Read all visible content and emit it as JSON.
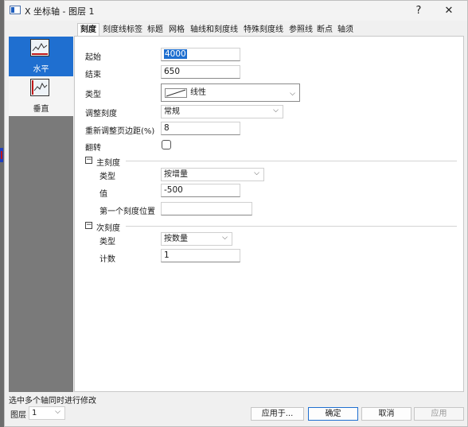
{
  "window": {
    "title": "X 坐标轴 - 图层 1",
    "help_label": "?",
    "close_label": "✕"
  },
  "sidebar": {
    "items": [
      {
        "label": "水平",
        "icon": "horizontal-axis-icon",
        "active": true
      },
      {
        "label": "垂直",
        "icon": "vertical-axis-icon",
        "active": false
      }
    ]
  },
  "tabs": [
    {
      "label": "刻度",
      "active": true
    },
    {
      "label": "刻度线标签"
    },
    {
      "label": "标题"
    },
    {
      "label": "网格"
    },
    {
      "label": "轴线和刻度线"
    },
    {
      "label": "特殊刻度线"
    },
    {
      "label": "参照线"
    },
    {
      "label": "断点"
    },
    {
      "label": "轴须"
    }
  ],
  "form": {
    "start": {
      "label": "起始",
      "value": "4000"
    },
    "end": {
      "label": "结束",
      "value": "650"
    },
    "type": {
      "label": "类型",
      "value": "线性"
    },
    "rescale": {
      "label": "调整刻度",
      "value": "常规"
    },
    "rescale_margin": {
      "label": "重新调整页边距(%)",
      "value": "8"
    },
    "flip": {
      "label": "翻转",
      "checked": false
    }
  },
  "major": {
    "header": "主刻度",
    "type_label": "类型",
    "type_value": "按增量",
    "value_label": "值",
    "value": "-500",
    "first_tick_label": "第一个刻度位置",
    "first_tick_value": ""
  },
  "minor": {
    "header": "次刻度",
    "type_label": "类型",
    "type_value": "按数量",
    "count_label": "计数",
    "count_value": "1"
  },
  "footer": {
    "status": "选中多个轴同时进行修改",
    "layer_label": "图层",
    "layer_value": "1",
    "apply_to": "应用于...",
    "ok": "确定",
    "cancel": "取消",
    "apply": "应用"
  },
  "colors": {
    "accent": "#1f6fd0",
    "sidebar_bg": "#7a7a7a"
  }
}
